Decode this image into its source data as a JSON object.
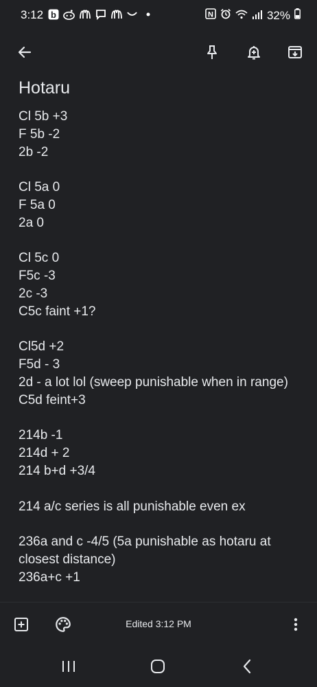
{
  "status_bar": {
    "time": "3:12",
    "battery": "32%",
    "left_icons": [
      "b-app-icon",
      "reddit-icon",
      "mcdonalds-icon",
      "message-icon",
      "mcdonalds-icon",
      "smile-icon",
      "dot-icon"
    ],
    "right_icons": [
      "nfc-icon",
      "alarm-icon",
      "wifi-icon",
      "signal-icon",
      "battery-icon"
    ]
  },
  "appbar": {
    "back_icon": "arrow-back-icon",
    "actions": [
      "pin-icon",
      "reminder-icon",
      "archive-icon"
    ]
  },
  "note": {
    "title": "Hotaru",
    "lines": [
      "Cl 5b +3",
      "F 5b -2",
      "2b -2",
      "",
      "Cl 5a 0",
      "F 5a 0",
      "2a 0",
      "",
      "Cl 5c 0",
      "F5c -3",
      "2c -3",
      "C5c faint +1?",
      "",
      "Cl5d +2",
      "F5d - 3",
      "2d - a lot lol (sweep punishable when in range)",
      "C5d feint+3",
      "",
      "214b -1",
      "214d + 2",
      "214 b+d +3/4",
      "",
      "214 a/c series is all punishable even ex",
      "",
      "236a and c -4/5 (5a punishable as hotaru at closest distance)",
      "236a+c +1"
    ]
  },
  "bottom_bar": {
    "edited_label": "Edited 3:12 PM",
    "left_icons": [
      "add-box-icon",
      "palette-icon"
    ],
    "right_icon": "more-vert-icon"
  },
  "nav_bar": {
    "buttons": [
      "recents-icon",
      "home-icon",
      "back-icon"
    ]
  },
  "colors": {
    "background": "#202124",
    "text": "#e8eaed"
  }
}
